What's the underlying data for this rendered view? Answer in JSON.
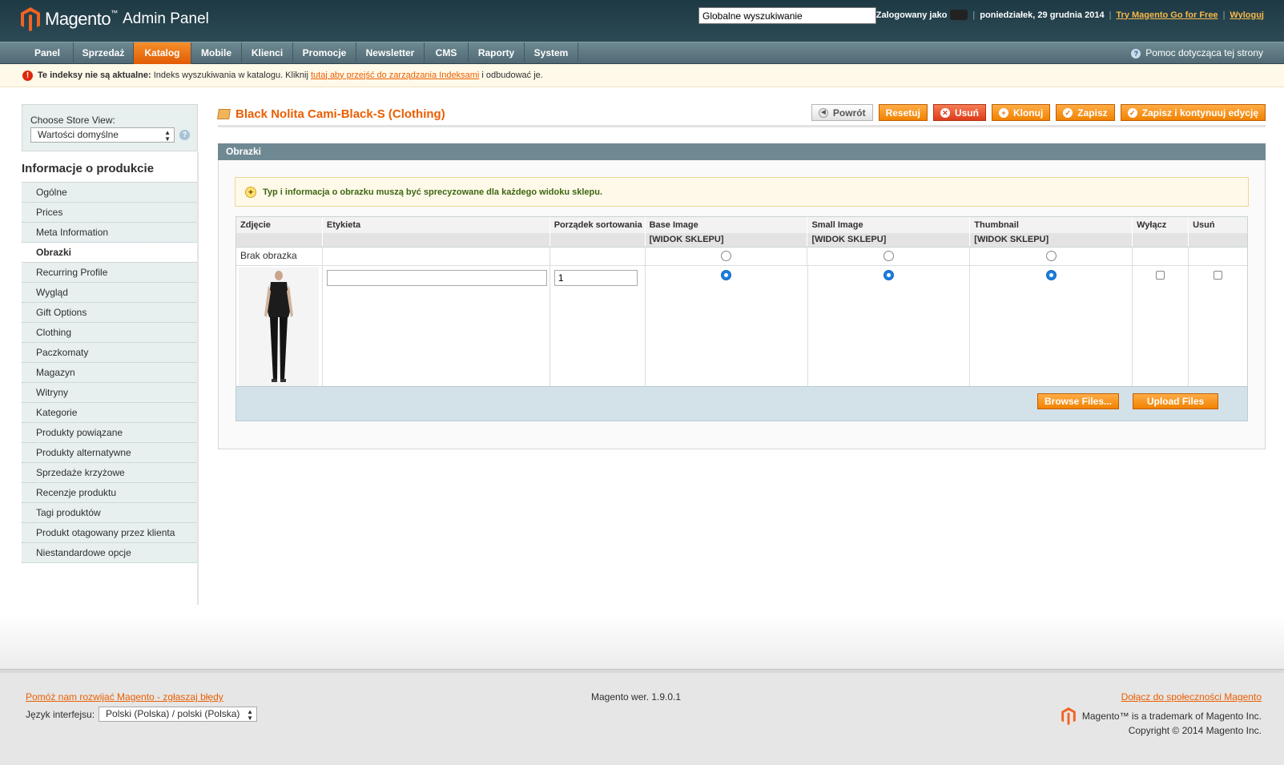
{
  "header": {
    "brand": "Magento",
    "brand_tm": "™",
    "brand_sub": "Admin Panel",
    "search_value": "Globalne wyszukiwanie",
    "logged_in_label": "Zalogowany jako",
    "date": "poniedziałek, 29 grudnia 2014",
    "try_link": "Try Magento Go for Free",
    "logout_link": "Wyloguj"
  },
  "nav": {
    "items": [
      "Panel",
      "Sprzedaż",
      "Katalog",
      "Mobile",
      "Klienci",
      "Promocje",
      "Newsletter",
      "CMS",
      "Raporty",
      "System"
    ],
    "active": "Katalog",
    "help": "Pomoc dotycząca tej strony"
  },
  "notice": {
    "bold": "Te indeksy nie są aktualne:",
    "text": "Indeks wyszukiwania w katalogu. Kliknij",
    "link": "tutaj aby przejść do zarządzania Indeksami",
    "after": "i odbudować je."
  },
  "sidebar": {
    "store_label": "Choose Store View:",
    "store_value": "Wartości domyślne",
    "title": "Informacje o produkcie",
    "tabs": [
      "Ogólne",
      "Prices",
      "Meta Information",
      "Obrazki",
      "Recurring Profile",
      "Wygląd",
      "Gift Options",
      "Clothing",
      "Paczkomaty",
      "Magazyn",
      "Witryny",
      "Kategorie",
      "Produkty powiązane",
      "Produkty alternatywne",
      "Sprzedaże krzyżowe",
      "Recenzje produktu",
      "Tagi produktów",
      "Produkt otagowany przez klienta",
      "Niestandardowe opcje"
    ],
    "active_tab": "Obrazki"
  },
  "content": {
    "title": "Black Nolita Cami-Black-S (Clothing)",
    "buttons": {
      "back": "Powrót",
      "reset": "Resetuj",
      "delete": "Usuń",
      "clone": "Klonuj",
      "save": "Zapisz",
      "save_continue": "Zapisz i kontynuuj edycję"
    },
    "section_title": "Obrazki",
    "tip": "Typ i informacja o obrazku muszą być sprecyzowane dla każdego widoku sklepu."
  },
  "grid": {
    "columns": [
      "Zdjęcie",
      "Etykieta",
      "Porządek sortowania",
      "Base Image",
      "Small Image",
      "Thumbnail",
      "Wyłącz",
      "Usuń"
    ],
    "scope": "[WIDOK SKLEPU]",
    "no_image_label": "Brak obrazka",
    "row": {
      "label_value": "",
      "sort_value": "1"
    }
  },
  "upload": {
    "browse": "Browse Files...",
    "upload": "Upload Files"
  },
  "footer": {
    "bug_link": "Pomóż nam rozwijać Magento - zgłaszaj błędy",
    "lang_label": "Język interfejsu:",
    "lang_value": "Polski (Polska) / polski (Polska)",
    "version": "Magento wer. 1.9.0.1",
    "community_link": "Dołącz do społeczności Magento",
    "trademark": "Magento™ is a trademark of Magento Inc.",
    "copyright": "Copyright © 2014 Magento Inc."
  },
  "colors": {
    "accent": "#eb5e00",
    "header_bg": "#1d3944",
    "nav_bg": "#5f7a83",
    "section_bg": "#6f8992"
  }
}
